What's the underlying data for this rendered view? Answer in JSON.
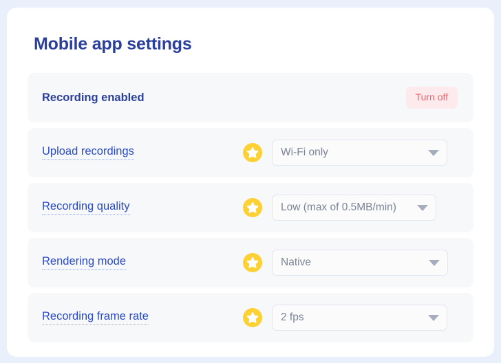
{
  "page": {
    "background_color": "#eaf0fb",
    "card_background": "#ffffff",
    "title": "Mobile app settings",
    "title_color": "#2b3f9e"
  },
  "colors": {
    "accent_blue": "#2b3f9e",
    "link_blue": "#2a4bc8",
    "star_yellow": "#fdd033",
    "danger_red": "#f4606c",
    "danger_bg": "#fdeaec",
    "row_bg": "#f7f8f9",
    "select_border": "#e2e5ec",
    "select_text": "#7b8496",
    "caret_gray": "#a5adbf"
  },
  "rows": [
    {
      "id": "recording-enabled",
      "label": "Recording enabled",
      "type": "toggle",
      "has_star": false,
      "button_label": "Turn off"
    },
    {
      "id": "upload-recordings",
      "label": "Upload recordings",
      "type": "select",
      "has_star": true,
      "star_icon": "star-icon",
      "value": "Wi-Fi only",
      "caret_icon": "chevron-down-icon"
    },
    {
      "id": "recording-quality",
      "label": "Recording quality",
      "type": "select",
      "has_star": true,
      "star_icon": "star-icon",
      "value": "Low (max of 0.5MB/min)",
      "caret_icon": "chevron-down-icon"
    },
    {
      "id": "rendering-mode",
      "label": "Rendering mode",
      "type": "select",
      "has_star": true,
      "star_icon": "star-icon",
      "value": "Native",
      "caret_icon": "chevron-down-icon"
    },
    {
      "id": "recording-frame-rate",
      "label": "Recording frame rate",
      "type": "select",
      "has_star": true,
      "star_icon": "star-icon",
      "value": "2 fps",
      "caret_icon": "chevron-down-icon"
    }
  ]
}
